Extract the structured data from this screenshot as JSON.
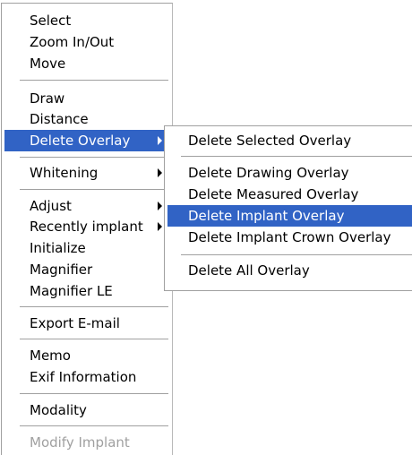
{
  "main_menu": {
    "items": [
      {
        "label": "Select"
      },
      {
        "label": "Zoom In/Out"
      },
      {
        "label": "Move"
      },
      {
        "label": "Draw"
      },
      {
        "label": "Distance"
      },
      {
        "label": "Delete Overlay",
        "has_submenu": true,
        "highlighted": true
      },
      {
        "label": "Whitening",
        "has_submenu": true
      },
      {
        "label": "Adjust",
        "has_submenu": true
      },
      {
        "label": "Recently implant",
        "has_submenu": true
      },
      {
        "label": "Initialize"
      },
      {
        "label": "Magnifier"
      },
      {
        "label": "Magnifier LE"
      },
      {
        "label": "Export E-mail"
      },
      {
        "label": "Memo"
      },
      {
        "label": "Exif Information"
      },
      {
        "label": "Modality"
      },
      {
        "label": "Modify Implant",
        "disabled": true
      }
    ]
  },
  "submenu": {
    "items": [
      {
        "label": "Delete Selected Overlay"
      },
      {
        "label": "Delete Drawing Overlay"
      },
      {
        "label": "Delete Measured Overlay"
      },
      {
        "label": "Delete Implant Overlay",
        "highlighted": true
      },
      {
        "label": "Delete Implant Crown Overlay"
      },
      {
        "label": "Delete All Overlay"
      }
    ]
  },
  "colors": {
    "highlight_bg": "#3163c5",
    "highlight_text": "#ffffff",
    "disabled_text": "#a0a0a0",
    "separator": "#a0a0a0"
  }
}
